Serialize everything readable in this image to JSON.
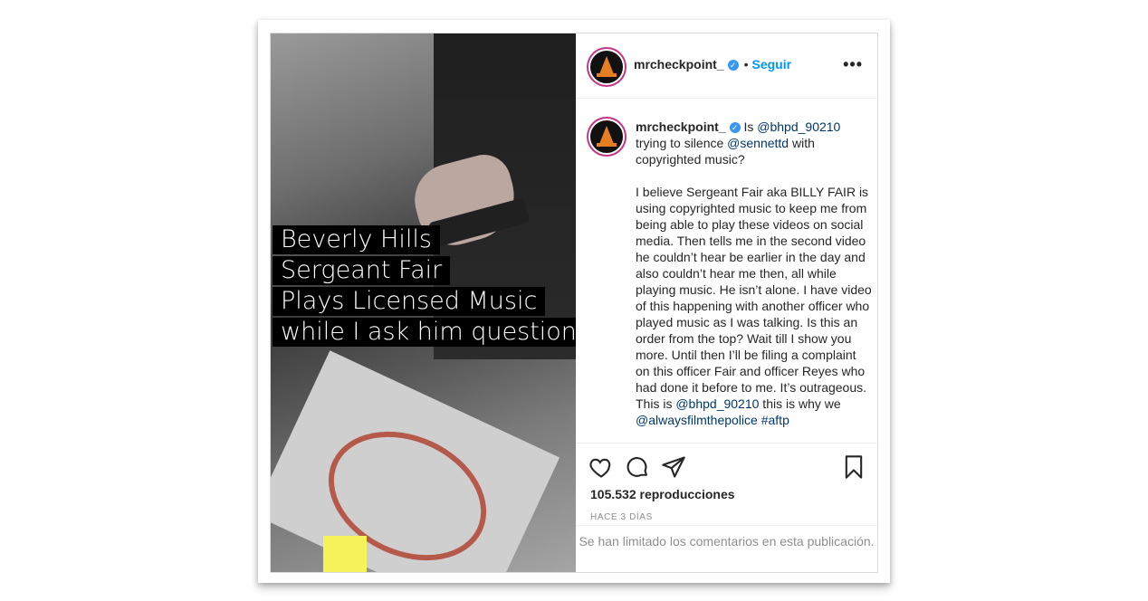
{
  "media": {
    "caption_lines": [
      "Beverly Hills",
      "Sergeant Fair",
      "Plays Licensed Music",
      "while I ask him questions"
    ]
  },
  "header": {
    "username": "mrcheckpoint_",
    "separator": "•",
    "follow_label": "Seguir",
    "more_label": "•••"
  },
  "comment": {
    "username": "mrcheckpoint_",
    "parts": [
      {
        "t": "Is ",
        "m": false
      },
      {
        "t": "@bhpd_90210",
        "m": true
      },
      {
        "t": " trying to silence ",
        "m": false
      },
      {
        "t": "@sennettd",
        "m": true
      },
      {
        "t": " with copyrighted music?",
        "m": false
      }
    ],
    "paragraph2_a": "I believe Sergeant Fair aka BILLY FAIR is using copyrighted music to keep me from being able to play these videos on social media. Then tells me in the second video he couldn’t hear be earlier in the day and also couldn’t hear me then, all while playing music. He isn’t alone. I have video of this happening with another officer who played music as I was talking. Is this an order from the top? Wait till I show you more. Until then I’ll be filing a complaint on this officer Fair and officer Reyes who had done it before to me. It’s outrageous. This is ",
    "mention3": "@bhpd_90210",
    "paragraph2_b": " this is why we ",
    "mention4": "@alwaysfilmthepolice",
    "hashtag": " #aftp"
  },
  "stats": {
    "views": "105.532 reproducciones",
    "time": "HACE 3 DÍAS"
  },
  "comments_limited": "Se han limitado los comentarios en esta publicación.",
  "icons": [
    "heart-icon",
    "comment-icon",
    "share-icon",
    "bookmark-icon",
    "verified-badge-icon"
  ]
}
